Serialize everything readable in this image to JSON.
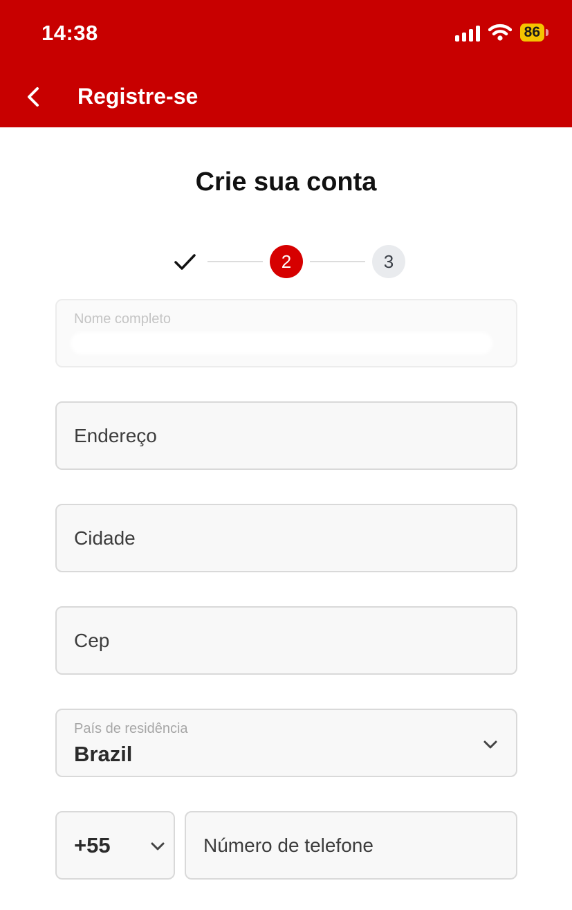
{
  "status_bar": {
    "time": "14:38",
    "battery": "86"
  },
  "nav": {
    "title": "Registre-se"
  },
  "page": {
    "title": "Crie sua conta"
  },
  "stepper": {
    "step2": "2",
    "step3": "3"
  },
  "form": {
    "full_name_label": "Nome completo",
    "address_placeholder": "Endereço",
    "city_placeholder": "Cidade",
    "zip_placeholder": "Cep",
    "country_label": "País de residência",
    "country_value": "Brazil",
    "phone_code": "+55",
    "phone_placeholder": "Número de telefone"
  },
  "colors": {
    "brand_red": "#c80000",
    "active_step": "#d60000",
    "battery_yellow": "#f5c400"
  }
}
